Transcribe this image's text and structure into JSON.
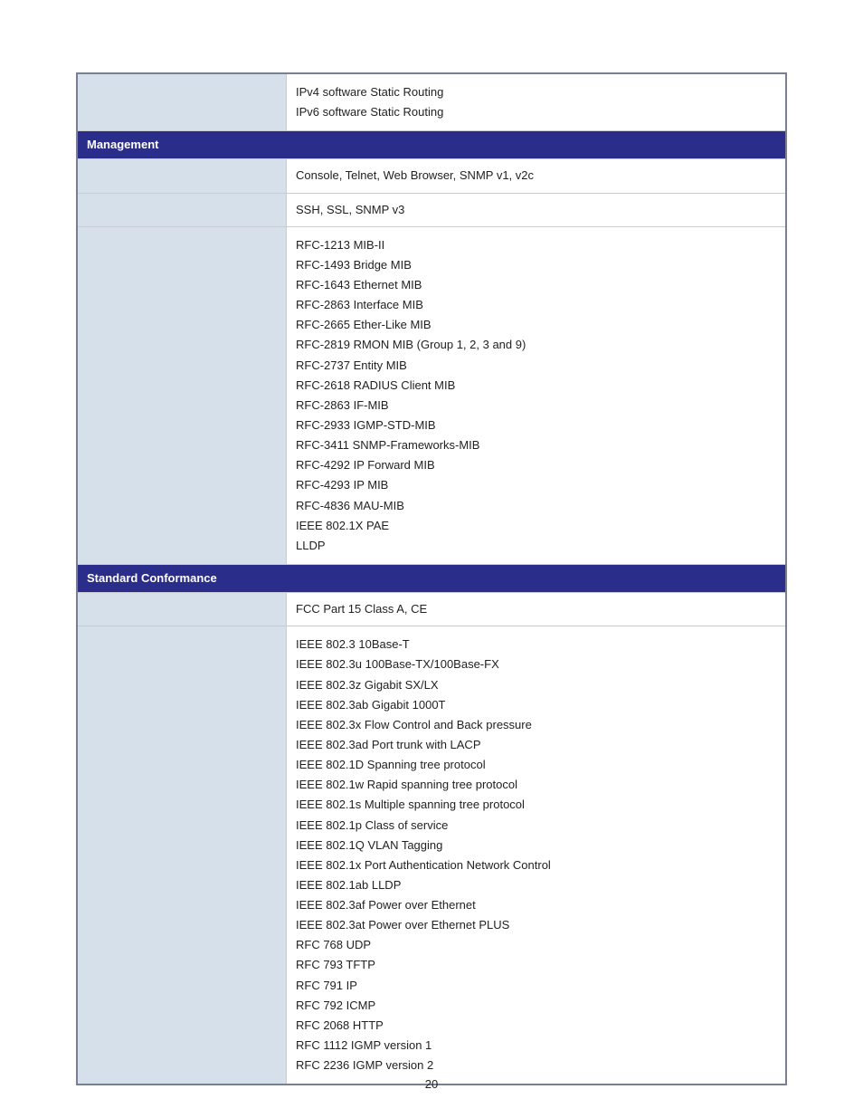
{
  "rows": {
    "routing": {
      "label": "",
      "lines": [
        "IPv4 software Static Routing",
        "IPv6 software Static Routing"
      ]
    },
    "mgmt_section": "Management",
    "basic_mgmt": {
      "label": "",
      "value": "Console, Telnet, Web Browser, SNMP v1, v2c"
    },
    "secure_mgmt": {
      "label": "",
      "value": "SSH, SSL, SNMP v3"
    },
    "mibs": {
      "label": "",
      "lines": [
        "RFC-1213 MIB-II",
        "RFC-1493 Bridge MIB",
        "RFC-1643 Ethernet MIB",
        "RFC-2863 Interface MIB",
        "RFC-2665 Ether-Like MIB",
        "RFC-2819 RMON MIB (Group 1, 2, 3 and 9)",
        "RFC-2737 Entity MIB",
        "RFC-2618 RADIUS Client MIB",
        "RFC-2863 IF-MIB",
        "RFC-2933 IGMP-STD-MIB",
        "RFC-3411 SNMP-Frameworks-MIB",
        "RFC-4292 IP Forward MIB",
        "RFC-4293 IP MIB",
        "RFC-4836 MAU-MIB",
        "IEEE 802.1X PAE",
        "LLDP"
      ]
    },
    "std_section": "Standard Conformance",
    "reg": {
      "label": "",
      "value": "FCC Part 15 Class A, CE"
    },
    "compliance": {
      "label": "",
      "lines": [
        "IEEE 802.3 10Base-T",
        "IEEE 802.3u 100Base-TX/100Base-FX",
        "IEEE 802.3z Gigabit SX/LX",
        "IEEE 802.3ab Gigabit 1000T",
        "IEEE 802.3x Flow Control and Back pressure",
        "IEEE 802.3ad Port trunk with LACP",
        "IEEE 802.1D Spanning tree protocol",
        "IEEE 802.1w Rapid spanning tree protocol",
        "IEEE 802.1s Multiple spanning tree protocol",
        "IEEE 802.1p Class of service",
        "IEEE 802.1Q VLAN Tagging",
        "IEEE 802.1x Port Authentication Network Control",
        "IEEE 802.1ab LLDP",
        "IEEE 802.3af Power over Ethernet",
        "IEEE 802.3at Power over Ethernet PLUS",
        "RFC 768 UDP",
        "RFC 793 TFTP",
        "RFC 791 IP",
        "RFC 792 ICMP",
        "RFC 2068 HTTP",
        "RFC 1112 IGMP version 1",
        "RFC 2236 IGMP version 2"
      ]
    }
  },
  "page_number": "20"
}
